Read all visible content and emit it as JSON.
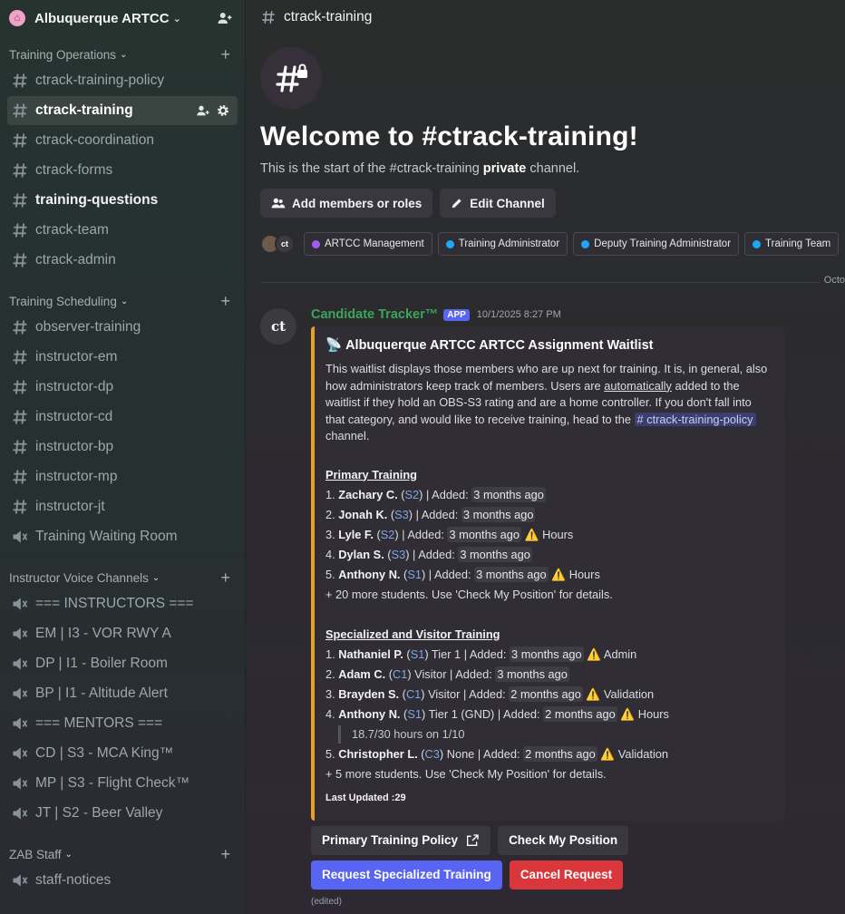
{
  "server": {
    "name": "Albuquerque ARTCC"
  },
  "sidebar": {
    "categories": [
      {
        "label": "Training Operations",
        "channels": [
          {
            "label": "ctrack-training-policy"
          },
          {
            "label": "ctrack-training"
          },
          {
            "label": "ctrack-coordination"
          },
          {
            "label": "ctrack-forms"
          },
          {
            "label": "training-questions"
          },
          {
            "label": "ctrack-team"
          },
          {
            "label": "ctrack-admin"
          }
        ]
      },
      {
        "label": "Training Scheduling",
        "channels": [
          {
            "label": "observer-training"
          },
          {
            "label": "instructor-em"
          },
          {
            "label": "instructor-dp"
          },
          {
            "label": "instructor-cd"
          },
          {
            "label": "instructor-bp"
          },
          {
            "label": "instructor-mp"
          },
          {
            "label": "instructor-jt"
          },
          {
            "label": "Training Waiting Room"
          }
        ]
      },
      {
        "label": "Instructor Voice Channels",
        "channels": [
          {
            "label": "=== INSTRUCTORS ==="
          },
          {
            "label": "EM | I3 - VOR RWY A"
          },
          {
            "label": "DP | I1 - Boiler Room"
          },
          {
            "label": "BP | I1 - Altitude Alert"
          },
          {
            "label": "=== MENTORS ==="
          },
          {
            "label": "CD | S3 - MCA King™"
          },
          {
            "label": "MP | S3 - Flight Check™"
          },
          {
            "label": "JT | S2 - Beer Valley"
          }
        ]
      },
      {
        "label": "ZAB Staff",
        "channels": [
          {
            "label": "staff-notices"
          }
        ]
      }
    ]
  },
  "channel": {
    "name": "ctrack-training",
    "welcome_title": "Welcome to #ctrack-training!",
    "welcome_pre": "This is the start of the #ctrack-training ",
    "welcome_bold": "private",
    "welcome_post": " channel.",
    "add_members_label": "Add members or roles",
    "edit_channel_label": "Edit Channel",
    "avatar2_text": "ct",
    "roles": [
      {
        "label": "ARTCC Management",
        "color": "#a35cf0"
      },
      {
        "label": "Training Administrator",
        "color": "#1ea7fd"
      },
      {
        "label": "Deputy Training Administrator",
        "color": "#1ea7fd"
      },
      {
        "label": "Training Team",
        "color": "#1ea7fd"
      }
    ],
    "date_divider": "Octo"
  },
  "message": {
    "avatar_text": "ct",
    "author": "Candidate Tracker™",
    "badge": "APP",
    "timestamp": "10/1/2025 8:27 PM",
    "embed": {
      "accent": "#e8a026",
      "icon": "📡",
      "title": "Albuquerque ARTCC ARTCC Assignment Waitlist",
      "desc_1": "This waitlist displays those members who are up next for training. It is, in general, also how administrators keep track of members. Users are ",
      "desc_u": "automatically",
      "desc_2": " added to the waitlist if they hold an OBS-S3 rating and are a home controller. If you don't fall into that category, and would like to receive training, head to the ",
      "desc_link": "# ctrack-training-policy",
      "desc_3": " channel.",
      "primary_title": "Primary Training",
      "primary": [
        {
          "num": "1.",
          "name": "Zachary C.",
          "open": " (",
          "rating": "S2",
          "mid": ") | Added: ",
          "ago": "3 months ago",
          "warn": "",
          "note": ""
        },
        {
          "num": "2.",
          "name": "Jonah K.",
          "open": " (",
          "rating": "S3",
          "mid": ") | Added: ",
          "ago": "3 months ago",
          "warn": "",
          "note": ""
        },
        {
          "num": "3.",
          "name": "Lyle F.",
          "open": " (",
          "rating": "S2",
          "mid": ") | Added: ",
          "ago": "3 months ago",
          "warn": "⚠️",
          "note": "Hours"
        },
        {
          "num": "4.",
          "name": "Dylan S.",
          "open": " (",
          "rating": "S3",
          "mid": ") | Added: ",
          "ago": "3 months ago",
          "warn": "",
          "note": ""
        },
        {
          "num": "5.",
          "name": "Anthony N.",
          "open": " (",
          "rating": "S1",
          "mid": ") | Added: ",
          "ago": "3 months ago",
          "warn": "⚠️",
          "note": "Hours"
        }
      ],
      "primary_more": "+ 20 more students. Use 'Check My Position' for details.",
      "special_title": "Specialized and Visitor Training",
      "special": [
        {
          "num": "1.",
          "name": "Nathaniel P.",
          "open": " (",
          "rating": "S1",
          "mid": ") Tier 1 | Added: ",
          "ago": "3 months ago",
          "warn": "⚠️",
          "note": "Admin"
        },
        {
          "num": "2.",
          "name": "Adam C.",
          "open": " (",
          "rating": "C1",
          "mid": ") Visitor | Added: ",
          "ago": "3 months ago",
          "warn": "",
          "note": ""
        },
        {
          "num": "3.",
          "name": "Brayden S.",
          "open": " (",
          "rating": "C1",
          "mid": ") Visitor | Added: ",
          "ago": "2 months ago",
          "warn": "⚠️",
          "note": "Validation"
        },
        {
          "num": "4.",
          "name": "Anthony N.",
          "open": " (",
          "rating": "S1",
          "mid": ") Tier 1 (GND) | Added: ",
          "ago": "2 months ago",
          "warn": "⚠️",
          "note": "Hours",
          "quote": "18.7/30 hours on 1/10"
        },
        {
          "num": "5.",
          "name": "Christopher L.",
          "open": " (",
          "rating": "C3",
          "mid": ") None | Added: ",
          "ago": "2 months ago",
          "warn": "⚠️",
          "note": "Validation"
        }
      ],
      "special_more": "+ 5 more students. Use 'Check My Position' for details.",
      "footer": "Last Updated :29"
    },
    "buttons": {
      "policy": "Primary Training Policy",
      "check": "Check My Position",
      "request": "Request Specialized Training",
      "cancel": "Cancel Request"
    },
    "edited": "(edited)"
  }
}
